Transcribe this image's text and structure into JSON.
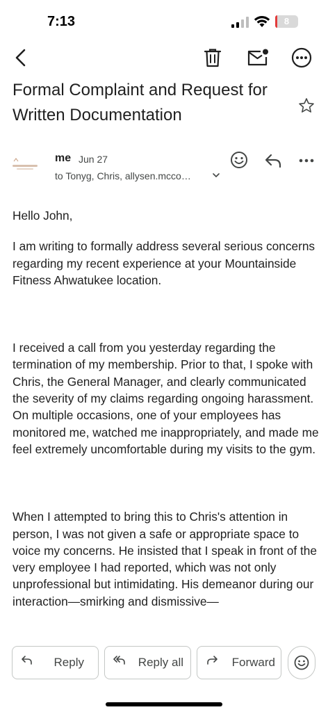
{
  "status_bar": {
    "time": "7:13",
    "battery_level": "8",
    "battery_fraction": 0.08,
    "battery_color": "#e23b3b"
  },
  "toolbar": {
    "icons": [
      "back-arrow-icon",
      "trash-icon",
      "mail-unread-icon",
      "more-horizontal-icon"
    ]
  },
  "email": {
    "subject": "Formal Complaint and Request for Written Documentation",
    "sender": "me",
    "date": "Jun 27",
    "recipients": "to Tonyg, Chris, allysen.mcco…",
    "body": [
      "Hello John,",
      "I am writing to formally address several serious concerns regarding my recent experience at your Mountainside Fitness Ahwatukee location.",
      "I received a call from you yesterday regarding the termination of my membership. Prior to that, I spoke with Chris, the General Manager, and clearly communicated the severity of my claims regarding ongoing harassment. On multiple occasions, one of your employees has monitored me, watched me inappropriately, and made me feel extremely uncomfortable during my visits to the gym.",
      "When I attempted to bring this to Chris's attention in person, I was not given a safe or appropriate space to voice my concerns. He insisted that I speak in front of the very employee I had reported, which was not only unprofessional but intimidating. His demeanor during our interaction—smirking and dismissive—"
    ]
  },
  "actions": {
    "reply": "Reply",
    "reply_all": "Reply all",
    "forward": "Forward"
  },
  "colors": {
    "text_primary": "#1f1f1f",
    "text_secondary": "#444746",
    "outline": "#c4c7c5"
  }
}
